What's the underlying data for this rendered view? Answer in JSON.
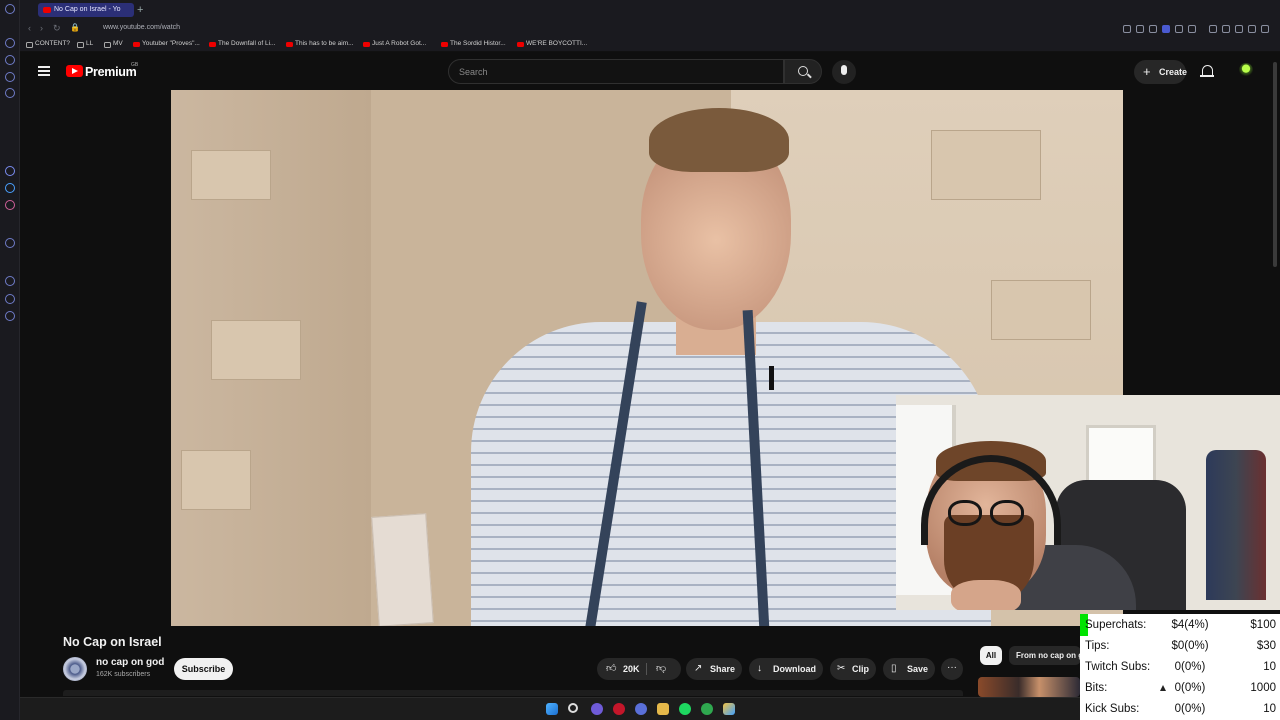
{
  "browser": {
    "tab_title": "No Cap on Israel - Yo",
    "new_tab_symbol": "+",
    "url": "www.youtube.com/watch",
    "bookmarks": [
      "CONTENT?",
      "LL",
      "MV",
      "Youtuber \"Proves\"...",
      "The Downfall of Li...",
      "This has to be aim...",
      "Just A Robot Got...",
      "The Sordid Histor...",
      "WE'RE BOYCOTTI..."
    ]
  },
  "header": {
    "logo_text": "Premium",
    "region": "GB",
    "search_placeholder": "Search",
    "create_label": "Create",
    "plus_symbol": "+"
  },
  "video": {
    "title": "No Cap on Israel",
    "channel_name": "no cap on god",
    "subscribers": "162K subscribers",
    "subscribe_label": "Subscribe",
    "like_count": "20K",
    "actions": {
      "share": "Share",
      "download": "Download",
      "clip": "Clip",
      "save": "Save"
    },
    "more_symbol": "···"
  },
  "recommendations": {
    "chips": [
      "All",
      "From no cap on god"
    ]
  },
  "stats_overlay": {
    "rows": [
      {
        "label": "Superchats:",
        "value": "$4(4%)",
        "goal": "$100"
      },
      {
        "label": "Tips:",
        "value": "$0(0%)",
        "goal": "$30"
      },
      {
        "label": "Twitch Subs:",
        "value": "0(0%)",
        "goal": "10"
      },
      {
        "label": "Bits:",
        "value": "0(0%)",
        "goal": "1000"
      },
      {
        "label": "Kick Subs:",
        "value": "0(0%)",
        "goal": "10"
      }
    ],
    "accent_color": "#00e400"
  },
  "colors": {
    "youtube_red": "#ff0000",
    "tab_active": "#2b2f77",
    "background": "#0f0f0f"
  }
}
